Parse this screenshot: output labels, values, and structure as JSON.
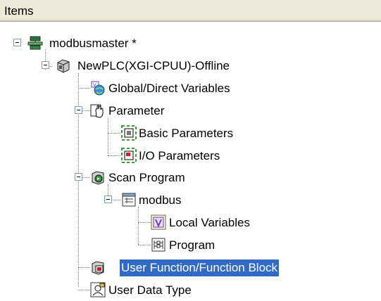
{
  "header": {
    "title": "Items"
  },
  "tree": {
    "root": {
      "label": "modbusmaster *",
      "icon": "project-network-icon"
    },
    "plc": {
      "label": "NewPLC(XGI-CPUU)-Offline",
      "icon": "plc-cube-icon"
    },
    "global_vars": {
      "label": "Global/Direct Variables",
      "icon": "global-variables-icon"
    },
    "parameter": {
      "label": "Parameter",
      "icon": "parameter-hand-icon"
    },
    "basic_params": {
      "label": "Basic Parameters",
      "icon": "basic-parameter-icon"
    },
    "io_params": {
      "label": "I/O Parameters",
      "icon": "io-parameter-icon"
    },
    "scan_program": {
      "label": "Scan Program",
      "icon": "scan-program-icon"
    },
    "modbus": {
      "label": "modbus",
      "icon": "program-window-icon"
    },
    "local_vars": {
      "label": "Local Variables",
      "icon": "local-variables-icon"
    },
    "program": {
      "label": "Program",
      "icon": "ladder-program-icon"
    },
    "user_function": {
      "label": "User Function/Function Block",
      "icon": "function-block-icon",
      "selected": true
    },
    "user_data_type": {
      "label": "User Data Type",
      "icon": "user-data-type-icon"
    }
  },
  "colors": {
    "selection": "#316ac5",
    "header": "#ece9d8"
  }
}
